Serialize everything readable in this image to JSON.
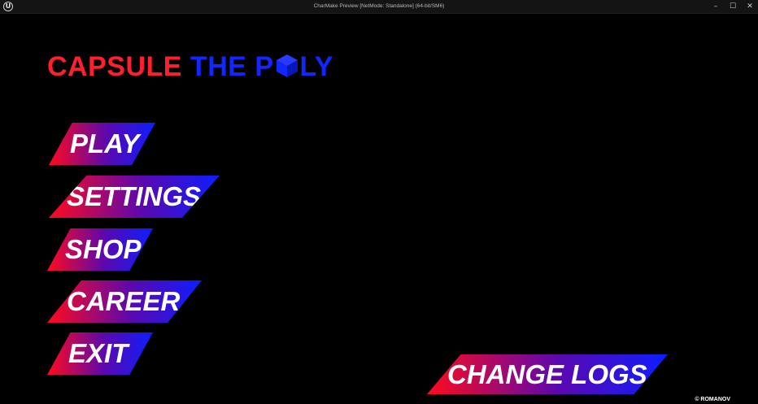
{
  "window": {
    "title": "CharMake Preview [NetMode: Standalone] (64-bit/SM6)",
    "app_icon": "U",
    "minimize": "–",
    "maximize": "☐",
    "close": "✕"
  },
  "game_title": {
    "part1": "CAPSULE",
    "part2_a": "THE P",
    "part2_b": "LY",
    "logo_icon": "cube-icon",
    "colors": {
      "red": "#ff1f2e",
      "blue": "#1226ff"
    }
  },
  "menu": {
    "play": "PLAY",
    "settings": "SETTINGS",
    "shop": "SHOP",
    "career": "CAREER",
    "exit": "EXIT"
  },
  "change_logs": "CHANGE LOGS",
  "copyright": "© ROMANOV",
  "button_gradient": {
    "start": "#ff0a1c",
    "end": "#0c1eff"
  }
}
